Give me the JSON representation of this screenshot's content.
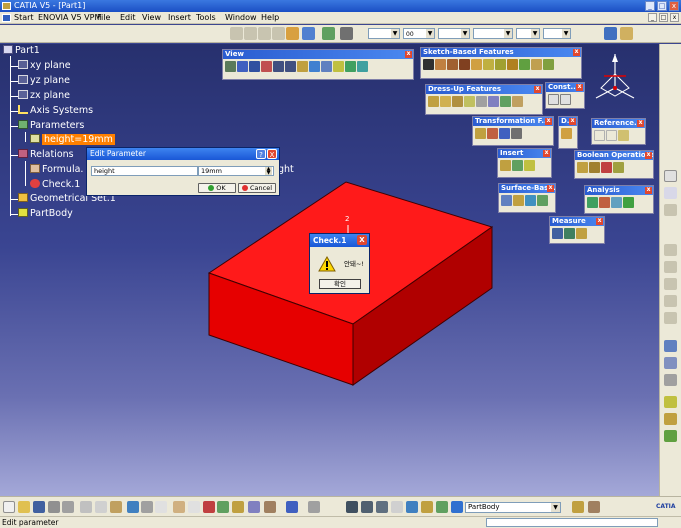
{
  "window": {
    "title": "CATIA V5 - [Part1]"
  },
  "menu": {
    "items": [
      "Start",
      "ENOVIA V5 VPM",
      "File",
      "Edit",
      "View",
      "Insert",
      "Tools",
      "Window",
      "Help"
    ]
  },
  "toolbar_top": {
    "combo1_value": "",
    "combo2_value": "00",
    "combo3_value": "",
    "combo4_value": "",
    "combo5_value": ""
  },
  "tree": {
    "root": "Part1",
    "xy_plane": "xy plane",
    "yz_plane": "yz plane",
    "zx_plane": "zx plane",
    "axis_systems": "Axis Systems",
    "parameters": "Parameters",
    "height_param": "height=19mm",
    "relations": "Relations",
    "formula": "Formula.",
    "formula_suffix": "ght",
    "check": "Check.1",
    "geometrical_set": "Geometrical Set.1",
    "partbody": "PartBody"
  },
  "floating_toolbars": {
    "view": "View",
    "sketch_based": "Sketch-Based Features",
    "dress_up": "Dress-Up Features",
    "const": "Const...",
    "transformation": "Transformation F...",
    "d": "D..",
    "reference": "Reference...",
    "insert": "Insert",
    "boolean": "Boolean Operations",
    "surface_based": "Surface-Base...",
    "analysis": "Analysis",
    "measure": "Measure"
  },
  "edit_parameter": {
    "title": "Edit Parameter",
    "name_value": "height",
    "value": "19mm",
    "ok_label": "OK",
    "cancel_label": "Cancel",
    "help_label": "?",
    "close_label": "X"
  },
  "check_dialog": {
    "title": "Check.1",
    "message": "안돼~!",
    "ok_label": "확인",
    "close_label": "X"
  },
  "annotation_label": "2",
  "bottom": {
    "part_combo_value": "PartBody"
  },
  "status": {
    "text": "Edit parameter"
  },
  "colors": {
    "box_top": "#ff1a1a",
    "box_left": "#e00000",
    "box_right": "#a80000",
    "highlight": "#ff8000",
    "title_blue": "#1957d6"
  }
}
